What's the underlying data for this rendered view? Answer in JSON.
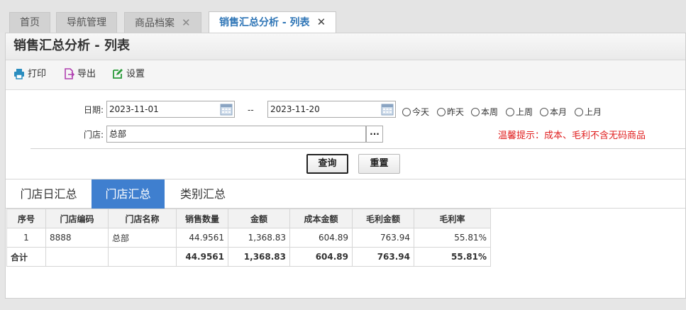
{
  "tabs": [
    {
      "label": "首页",
      "closable": false
    },
    {
      "label": "导航管理",
      "closable": false
    },
    {
      "label": "商品档案",
      "closable": true
    },
    {
      "label": "销售汇总分析 - 列表",
      "closable": true,
      "active": true
    }
  ],
  "panel": {
    "title": "销售汇总分析 - 列表"
  },
  "toolbar": {
    "print": "打印",
    "export": "导出",
    "settings": "设置"
  },
  "filter": {
    "date_label": "日期:",
    "date_from": "2023-11-01",
    "date_sep": "--",
    "date_to": "2023-11-20",
    "quick_ranges": [
      "今天",
      "昨天",
      "本周",
      "上周",
      "本月",
      "上月"
    ],
    "store_label": "门店:",
    "store_value": "总部",
    "store_more": "···",
    "hint": "温馨提示：成本、毛利不含无码商品"
  },
  "buttons": {
    "query": "查询",
    "reset": "重置"
  },
  "subtabs": [
    "门店日汇总",
    "门店汇总",
    "类别汇总"
  ],
  "subtab_active": 1,
  "table": {
    "headers": [
      "序号",
      "门店编码",
      "门店名称",
      "销售数量",
      "金额",
      "成本金额",
      "毛利金额",
      "毛利率"
    ],
    "rows": [
      [
        "1",
        "8888",
        "总部",
        "44.9561",
        "1,368.83",
        "604.89",
        "763.94",
        "55.81%"
      ]
    ],
    "total": [
      "合计",
      "",
      "",
      "44.9561",
      "1,368.83",
      "604.89",
      "763.94",
      "55.81%"
    ]
  },
  "colors": {
    "accent": "#3f7fcf",
    "hint": "#e02020",
    "tab_active_text": "#2e75b6"
  }
}
